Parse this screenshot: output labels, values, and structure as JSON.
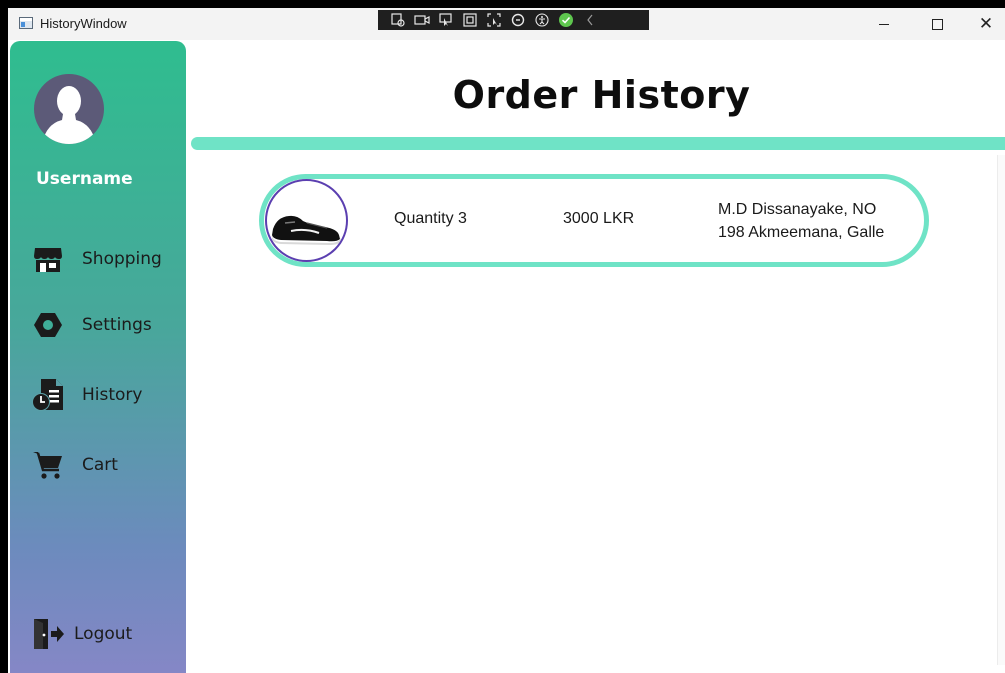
{
  "window": {
    "title": "HistoryWindow"
  },
  "sidebar": {
    "username": "Username",
    "items": [
      {
        "label": "Shopping",
        "icon": "store-icon"
      },
      {
        "label": "Settings",
        "icon": "hexagon-settings-icon"
      },
      {
        "label": "History",
        "icon": "history-document-icon"
      },
      {
        "label": "Cart",
        "icon": "cart-icon"
      }
    ],
    "logout_label": "Logout"
  },
  "main": {
    "title": "Order History",
    "orders": [
      {
        "quantity": "Quantity 3",
        "price": "3000 LKR",
        "address_line1": "M.D Dissanayake, NO",
        "address_line2": "198 Akmeemana, Galle",
        "product_icon": "sneaker-image"
      }
    ]
  },
  "colors": {
    "accent": "#6fe3c6",
    "sidebar_top": "#2fbd8f",
    "sidebar_bottom": "#8587c6",
    "thumb_border": "#5b3fb0",
    "avatar_bg": "#5c5a78"
  }
}
